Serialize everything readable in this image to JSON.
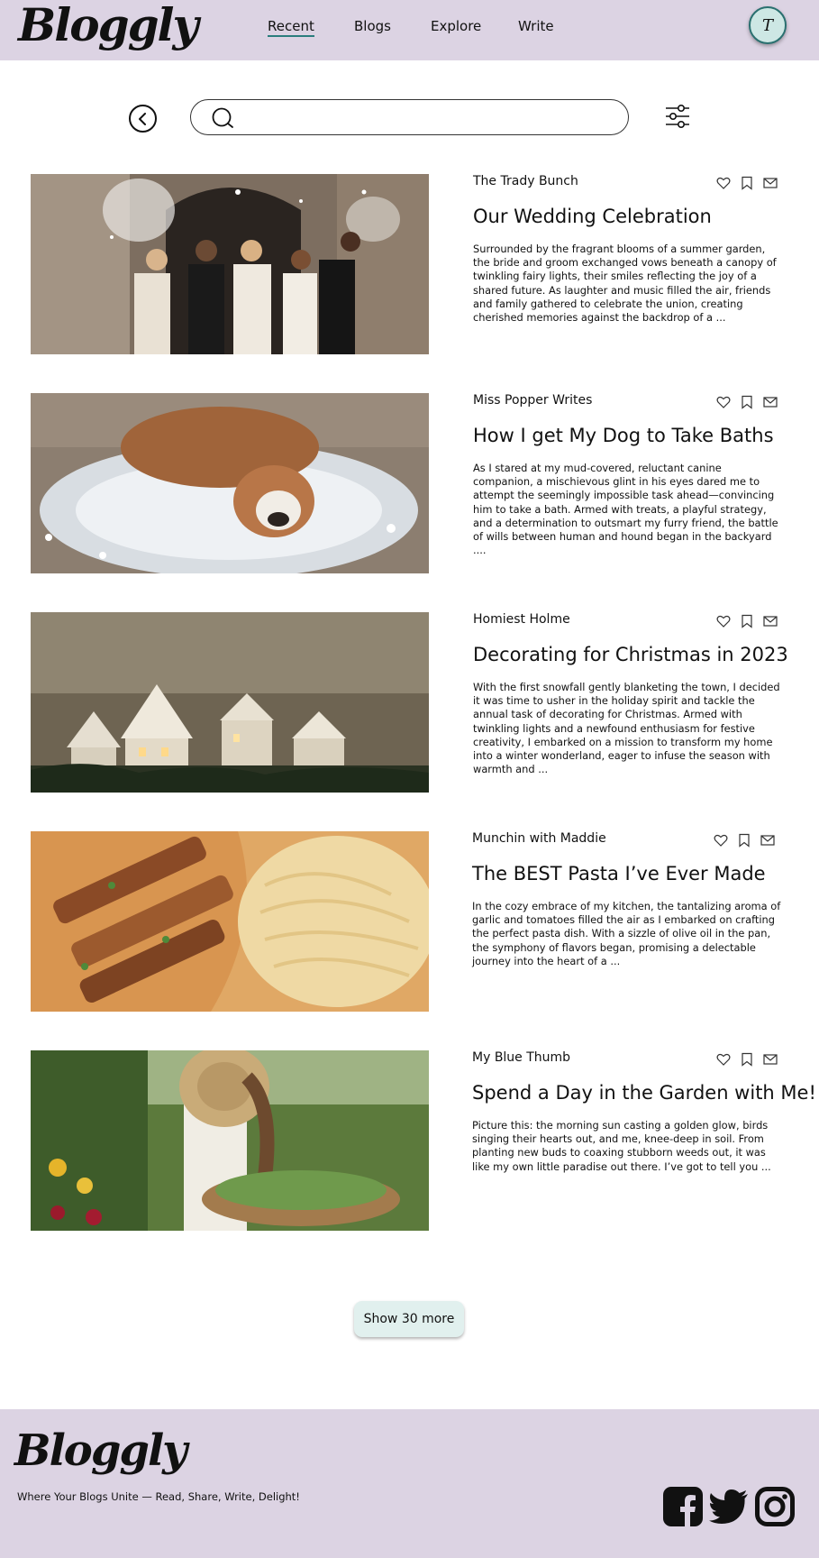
{
  "header": {
    "logo": "Bloggly",
    "nav": [
      {
        "label": "Recent",
        "active": true
      },
      {
        "label": "Blogs",
        "active": false
      },
      {
        "label": "Explore",
        "active": false
      },
      {
        "label": "Write",
        "active": false
      }
    ],
    "avatar_initial": "T"
  },
  "search": {
    "placeholder": "",
    "value": ""
  },
  "posts": [
    {
      "author": "The Trady Bunch",
      "title": "Our Wedding Celebration",
      "excerpt": "Surrounded by the fragrant blooms of a summer garden, the bride and groom exchanged vows beneath a canopy of twinkling fairy lights, their smiles reflecting the joy of a shared future. As laughter and music filled the air, friends and family gathered to celebrate the union, creating cherished memories against the backdrop of a ..."
    },
    {
      "author": "Miss Popper Writes",
      "title": "How I get My Dog to Take Baths",
      "excerpt": "As I stared at my mud-covered, reluctant canine companion, a mischievous glint in his eyes dared me to attempt the seemingly impossible task ahead—convincing him to take a bath. Armed with treats, a playful strategy, and a determination to outsmart my furry friend, the battle of wills between human and hound began in the backyard ...."
    },
    {
      "author": "Homiest Holme",
      "title": "Decorating for Christmas in 2023",
      "excerpt": "With the first snowfall gently blanketing the town, I decided it was time to usher in the holiday spirit and tackle the annual task of decorating for Christmas. Armed with twinkling lights and a newfound enthusiasm for festive creativity, I embarked on a mission to transform my home into a winter wonderland, eager to infuse the season with warmth and ..."
    },
    {
      "author": "Munchin with Maddie",
      "title": "The BEST Pasta I’ve Ever Made",
      "excerpt": "In the cozy embrace of my kitchen, the tantalizing aroma of garlic and tomatoes filled the air as I embarked on crafting the perfect pasta dish. With a sizzle of olive oil in the pan, the symphony of flavors began, promising a delectable journey into the heart of a ..."
    },
    {
      "author": "My Blue Thumb",
      "title": "Spend a Day in the Garden with Me!",
      "excerpt": "Picture this: the morning sun casting a golden glow, birds singing their hearts out, and me, knee-deep in soil. From planting new buds to coaxing stubborn weeds out, it was like my own little paradise out there. I’ve got to tell you ..."
    }
  ],
  "show_more_label": "Show 30 more",
  "footer": {
    "logo": "Bloggly",
    "tagline": "Where Your Blogs Unite — Read, Share, Write, Delight!"
  },
  "colors": {
    "header_bg": "#dcd3e3",
    "accent": "#2a7d7d",
    "button_bg": "#e1f0ee"
  }
}
